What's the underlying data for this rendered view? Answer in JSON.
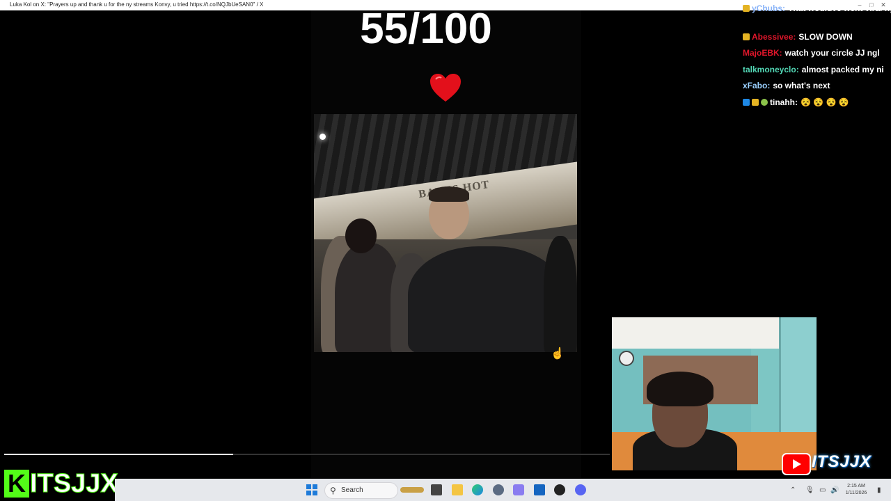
{
  "window": {
    "title": "Luka Kol on X: \"Prayers up and thank u for the ny streams Konvy, u tried https://t.co/NQJbUeSAN0\" / X"
  },
  "overlay": {
    "score": "55/100",
    "heart_icon": "red-heart-icon"
  },
  "video": {
    "sign_text": "BAKES HOT",
    "progress": 0.378
  },
  "chat": {
    "messages": [
      {
        "user": "yChubs:",
        "text": "That wouldve went viral ngl",
        "color": "#8ab4f8",
        "badges": [
          "crown-badge"
        ]
      },
      {
        "user": "Abessivee:",
        "text": "SLOW DOWN",
        "color": "#e0162b",
        "badges": [
          "crown-badge"
        ]
      },
      {
        "user": "MajoEBK:",
        "text": "watch your circle JJ ngl",
        "color": "#e0162b",
        "badges": []
      },
      {
        "user": "talkmoneyclo:",
        "text": "almost packed my ni",
        "color": "#53d8b6",
        "badges": []
      },
      {
        "user": "xFabo:",
        "text": "so what's next",
        "color": "#9ad0ff",
        "badges": []
      },
      {
        "user": "tinahh:",
        "text": "😵 😵 😵 😵",
        "color": "#ffffff",
        "badges": [
          "arrow-badge",
          "crown-badge",
          "star-badge"
        ]
      }
    ]
  },
  "branding": {
    "youtube_name": "ITSJJX",
    "kick_letter": "K",
    "kick_name": "ITSJJX",
    "kick_color": "#53fc18"
  },
  "taskbar": {
    "search_placeholder": "Search",
    "time": "2:15 AM",
    "date": "1/11/2026",
    "apps": [
      "task-view-icon",
      "file-explorer-icon",
      "edge-icon",
      "settings-icon",
      "app-icon",
      "store-icon",
      "obs-icon",
      "discord-icon"
    ]
  }
}
